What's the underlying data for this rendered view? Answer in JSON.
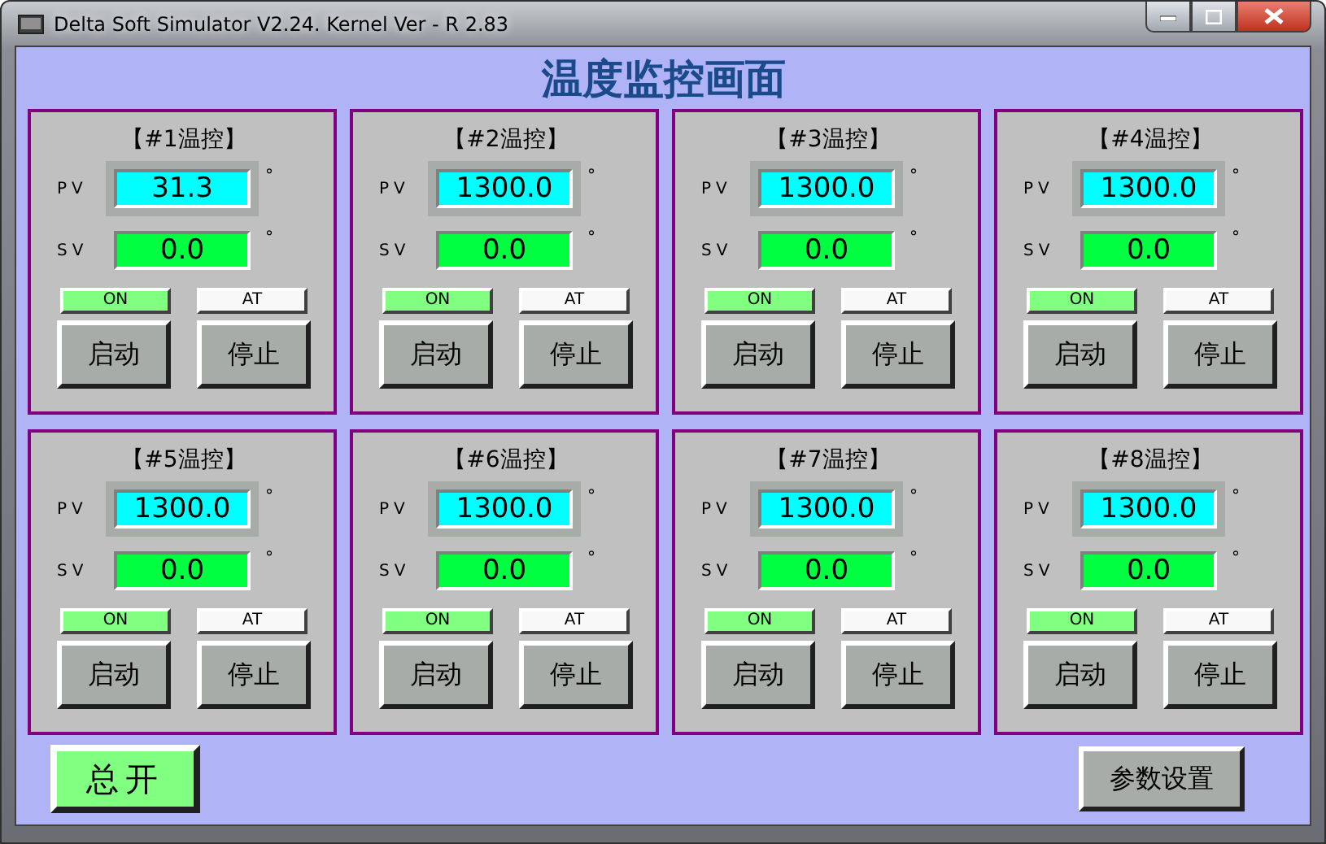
{
  "window": {
    "title": "Delta Soft Simulator V2.24. Kernel Ver - R 2.83"
  },
  "screen_title": "温度监控画面",
  "controllers": [
    {
      "title": "【#1温控】",
      "pv_label": "PV",
      "pv": "31.3",
      "pv_unit": "°",
      "sv_label": "SV",
      "sv": "0.0",
      "sv_unit": "°",
      "indicators": [
        {
          "label": "ON",
          "on": true
        },
        {
          "label": "AT",
          "on": false
        }
      ],
      "buttons": [
        "启动",
        "停止"
      ]
    },
    {
      "title": "【#2温控】",
      "pv_label": "PV",
      "pv": "1300.0",
      "pv_unit": "°",
      "sv_label": "SV",
      "sv": "0.0",
      "sv_unit": "°",
      "indicators": [
        {
          "label": "ON",
          "on": true
        },
        {
          "label": "AT",
          "on": false
        }
      ],
      "buttons": [
        "启动",
        "停止"
      ]
    },
    {
      "title": "【#3温控】",
      "pv_label": "PV",
      "pv": "1300.0",
      "pv_unit": "°",
      "sv_label": "SV",
      "sv": "0.0",
      "sv_unit": "°",
      "indicators": [
        {
          "label": "ON",
          "on": true
        },
        {
          "label": "AT",
          "on": false
        }
      ],
      "buttons": [
        "启动",
        "停止"
      ]
    },
    {
      "title": "【#4温控】",
      "pv_label": "PV",
      "pv": "1300.0",
      "pv_unit": "°",
      "sv_label": "SV",
      "sv": "0.0",
      "sv_unit": "°",
      "indicators": [
        {
          "label": "ON",
          "on": true
        },
        {
          "label": "AT",
          "on": false
        }
      ],
      "buttons": [
        "启动",
        "停止"
      ]
    },
    {
      "title": "【#5温控】",
      "pv_label": "PV",
      "pv": "1300.0",
      "pv_unit": "°",
      "sv_label": "SV",
      "sv": "0.0",
      "sv_unit": "°",
      "indicators": [
        {
          "label": "ON",
          "on": true
        },
        {
          "label": "AT",
          "on": false
        }
      ],
      "buttons": [
        "启动",
        "停止"
      ]
    },
    {
      "title": "【#6温控】",
      "pv_label": "PV",
      "pv": "1300.0",
      "pv_unit": "°",
      "sv_label": "SV",
      "sv": "0.0",
      "sv_unit": "°",
      "indicators": [
        {
          "label": "ON",
          "on": true
        },
        {
          "label": "AT",
          "on": false
        }
      ],
      "buttons": [
        "启动",
        "停止"
      ]
    },
    {
      "title": "【#7温控】",
      "pv_label": "PV",
      "pv": "1300.0",
      "pv_unit": "°",
      "sv_label": "SV",
      "sv": "0.0",
      "sv_unit": "°",
      "indicators": [
        {
          "label": "ON",
          "on": true
        },
        {
          "label": "AT",
          "on": false
        }
      ],
      "buttons": [
        "启动",
        "停止"
      ]
    },
    {
      "title": "【#8温控】",
      "pv_label": "PV",
      "pv": "1300.0",
      "pv_unit": "°",
      "sv_label": "SV",
      "sv": "0.0",
      "sv_unit": "°",
      "indicators": [
        {
          "label": "ON",
          "on": true
        },
        {
          "label": "AT",
          "on": false
        }
      ],
      "buttons": [
        "启动",
        "停止"
      ]
    }
  ],
  "main_switch": {
    "label": "总开",
    "on": true
  },
  "settings_button": {
    "label": "参数设置"
  }
}
